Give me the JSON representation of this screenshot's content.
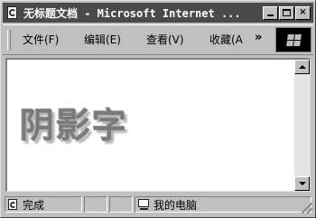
{
  "window": {
    "title": "无标题文档 - Microsoft Internet ..."
  },
  "titlebar_buttons": {
    "close_label": "×"
  },
  "menu": {
    "items": [
      {
        "label": "文件(F)"
      },
      {
        "label": "编辑(E)"
      },
      {
        "label": "查看(V)"
      },
      {
        "label": "收藏(A"
      }
    ],
    "overflow_label": "»"
  },
  "content": {
    "text": "阴影字"
  },
  "statusbar": {
    "status_text": "完成",
    "zone_text": "我的电脑"
  },
  "icons": [
    "ie-page-icon",
    "minimize-icon",
    "maximize-icon",
    "close-icon",
    "windows-logo-icon",
    "scroll-up-icon",
    "scroll-down-icon",
    "page-done-icon",
    "my-computer-icon"
  ]
}
